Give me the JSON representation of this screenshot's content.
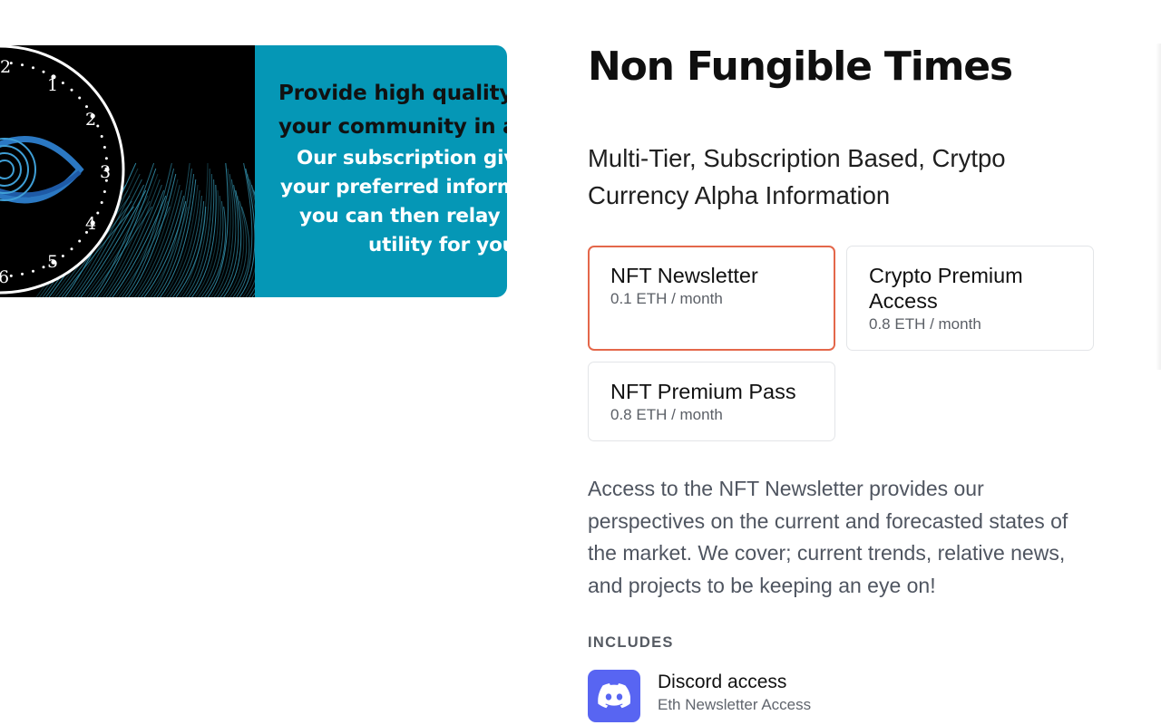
{
  "banner": {
    "clock_numbers": [
      "2",
      "1",
      "2",
      "3",
      "4",
      "5",
      "6"
    ],
    "text_lines": [
      "Provide high quality",
      "your community in a",
      "Our subscription give",
      "your preferred inform",
      "you can then relay it",
      "utility for your"
    ],
    "colors": {
      "teal": "#0597b6",
      "dark": "#000000",
      "eye": "#2b78c2"
    }
  },
  "product": {
    "title": "Non Fungible Times",
    "subtitle": "Multi-Tier, Subscription Based, Crytpo Currency Alpha Information"
  },
  "tiers": [
    {
      "name": "NFT Newsletter",
      "price": "0.1 ETH / month",
      "selected": true
    },
    {
      "name": "Crypto Premium Access",
      "price": "0.8 ETH / month",
      "selected": false
    },
    {
      "name": "NFT Premium Pass",
      "price": "0.8 ETH / month",
      "selected": false
    }
  ],
  "description": "Access to the NFT Newsletter provides our perspectives on the current and forecasted states of the market. We cover; current trends, relative news, and projects to be keeping an eye on!",
  "includes": {
    "heading": "INCLUDES",
    "items": [
      {
        "icon": "discord-icon",
        "name": "Discord access",
        "sub": "Eth Newsletter Access"
      }
    ]
  },
  "colors": {
    "accent": "#e4674a",
    "discord": "#5865f2"
  }
}
